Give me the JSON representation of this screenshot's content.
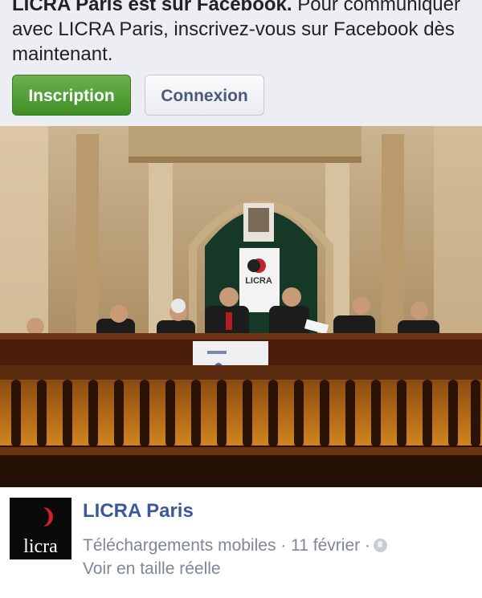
{
  "banner": {
    "bold_text": "LICRA Paris est sur Facebook.",
    "text": " Pour communiquer avec LICRA Paris, inscrivez-vous sur Facebook dès maintenant.",
    "signup_label": "Inscription",
    "login_label": "Connexion"
  },
  "photo": {
    "sign_text": "LICRA"
  },
  "post": {
    "page_name": "LICRA Paris",
    "album": "Téléchargements mobiles",
    "separator": "·",
    "date": "11 février",
    "audience_icon": "globe-icon",
    "view_full": "Voir en taille réelle",
    "avatar_text": "licra"
  },
  "colors": {
    "accent": "#3b5998",
    "signup_green": "#4a9a2c",
    "banner_bg": "#eceef3"
  }
}
